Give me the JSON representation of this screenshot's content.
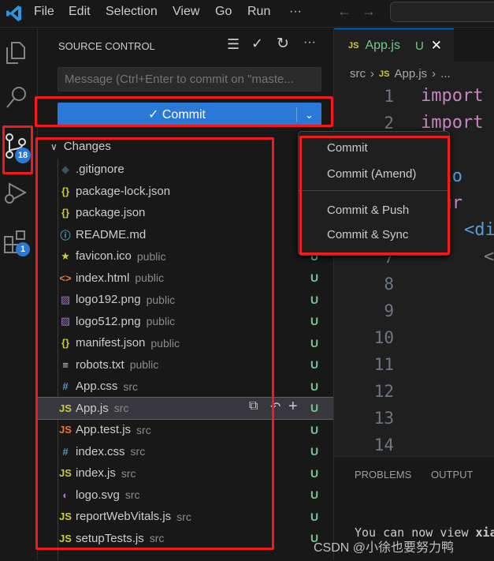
{
  "titlebar": {
    "menus": [
      "File",
      "Edit",
      "Selection",
      "View",
      "Go",
      "Run",
      "···"
    ]
  },
  "activity": {
    "source_control_badge": "18",
    "extensions_badge": "1"
  },
  "sidebar": {
    "title": "SOURCE CONTROL",
    "message_placeholder": "Message (Ctrl+Enter to commit on \"maste...",
    "commit_label": "✓ Commit",
    "changes_label": "Changes",
    "files": [
      {
        "name": ".gitignore",
        "dir": "",
        "icon": "◆",
        "color": "#41535b"
      },
      {
        "name": "package-lock.json",
        "dir": "",
        "icon": "{}",
        "color": "#cbcb41"
      },
      {
        "name": "package.json",
        "dir": "",
        "icon": "{}",
        "color": "#cbcb41"
      },
      {
        "name": "README.md",
        "dir": "",
        "icon": "ⓘ",
        "color": "#519aba"
      },
      {
        "name": "favicon.ico",
        "dir": "public",
        "icon": "★",
        "color": "#cbcb41",
        "status": "U"
      },
      {
        "name": "index.html",
        "dir": "public",
        "icon": "<>",
        "color": "#e37933",
        "status": "U"
      },
      {
        "name": "logo192.png",
        "dir": "public",
        "icon": "▨",
        "color": "#a074c4",
        "status": "U"
      },
      {
        "name": "logo512.png",
        "dir": "public",
        "icon": "▨",
        "color": "#a074c4",
        "status": "U"
      },
      {
        "name": "manifest.json",
        "dir": "public",
        "icon": "{}",
        "color": "#cbcb41",
        "status": "U"
      },
      {
        "name": "robots.txt",
        "dir": "public",
        "icon": "≡",
        "color": "#d4d7d6",
        "status": "U"
      },
      {
        "name": "App.css",
        "dir": "src",
        "icon": "#",
        "color": "#519aba",
        "status": "U"
      },
      {
        "name": "App.js",
        "dir": "src",
        "icon": "JS",
        "color": "#cbcb41",
        "status": "U",
        "selected": true
      },
      {
        "name": "App.test.js",
        "dir": "src",
        "icon": "JS",
        "color": "#e37933",
        "status": "U"
      },
      {
        "name": "index.css",
        "dir": "src",
        "icon": "#",
        "color": "#519aba",
        "status": "U"
      },
      {
        "name": "index.js",
        "dir": "src",
        "icon": "JS",
        "color": "#cbcb41",
        "status": "U"
      },
      {
        "name": "logo.svg",
        "dir": "src",
        "icon": "◐",
        "color": "#a074c4",
        "status": "U"
      },
      {
        "name": "reportWebVitals.js",
        "dir": "src",
        "icon": "JS",
        "color": "#cbcb41",
        "status": "U"
      },
      {
        "name": "setupTests.js",
        "dir": "src",
        "icon": "JS",
        "color": "#cbcb41",
        "status": "U"
      }
    ]
  },
  "dropdown": {
    "items": [
      "Commit",
      "Commit (Amend)",
      "Commit & Push",
      "Commit & Sync"
    ]
  },
  "editor": {
    "tab": {
      "icon": "JS",
      "name": "App.js",
      "status": "U"
    },
    "breadcrumb": {
      "folder": "src",
      "file": "App.js",
      "more": "..."
    },
    "line_numbers": [
      "1",
      "2",
      "3",
      "4",
      "5",
      "6",
      "7",
      "8",
      "9",
      "10",
      "11",
      "12",
      "13",
      "14"
    ],
    "code": [
      {
        "text": "import",
        "color": "#c586c0"
      },
      {
        "text": "import",
        "color": "#c586c0"
      },
      {
        "text": "",
        "color": "#ccc"
      },
      {
        "text": "ctio",
        "color": "#569cd6"
      },
      {
        "text": "etur",
        "color": "#c586c0"
      },
      {
        "text": "<di",
        "color": "#569cd6"
      },
      {
        "text": "<",
        "color": "#808080"
      }
    ]
  },
  "panel": {
    "tabs": [
      "PROBLEMS",
      "OUTPUT"
    ],
    "terminal_text": "You can now view ",
    "terminal_bold": "xia"
  },
  "watermark": "CSDN @小徐也要努力鸭",
  "colors": {
    "accent": "#2b79d7",
    "highlight": "#f01c1c",
    "untracked": "#73c991"
  }
}
